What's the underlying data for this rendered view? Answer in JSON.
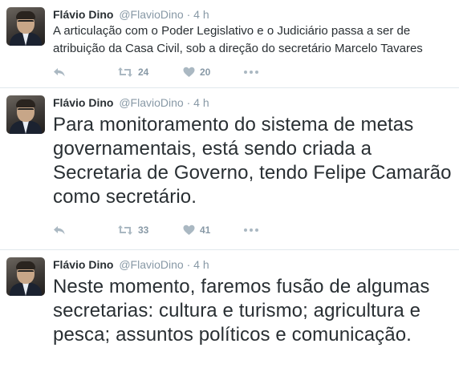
{
  "tweets": [
    {
      "author_name": "Flávio Dino",
      "author_handle": "@FlavioDino",
      "separator": "·",
      "time": "4 h",
      "text": "A articulação com o Poder Legislativo e o Judiciário passa a ser de atribuição da Casa Civil, sob a direção do secretário Marcelo Tavares",
      "retweets": "24",
      "likes": "20"
    },
    {
      "author_name": "Flávio Dino",
      "author_handle": "@FlavioDino",
      "separator": "·",
      "time": "4 h",
      "text": "Para monitoramento do sistema de metas governamentais, está sendo criada a Secretaria de Governo, tendo Felipe Camarão como secretário.",
      "retweets": "33",
      "likes": "41"
    },
    {
      "author_name": "Flávio Dino",
      "author_handle": "@FlavioDino",
      "separator": "·",
      "time": "4 h",
      "text": "Neste momento, faremos fusão de algumas secretarias: cultura e turismo; agricultura e pesca; assuntos políticos e comunicação."
    }
  ],
  "icons": {
    "reply": "reply-icon",
    "retweet": "retweet-icon",
    "like": "heart-icon",
    "more": "more-icon"
  },
  "colors": {
    "text": "#292f33",
    "muted": "#8899a6",
    "divider": "#e1e8ed"
  }
}
